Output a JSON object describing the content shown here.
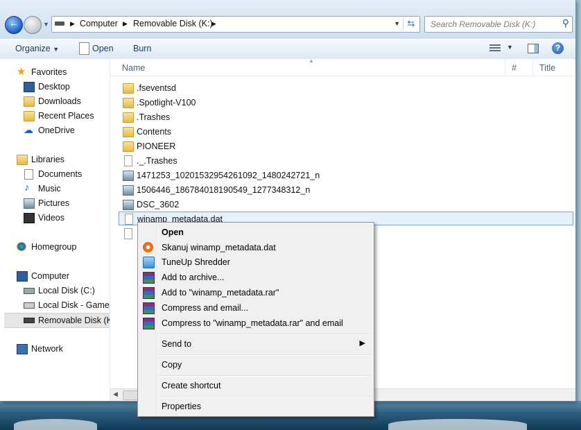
{
  "address_bar": {
    "segments": [
      "Computer",
      "Removable Disk (K:)"
    ]
  },
  "search": {
    "placeholder": "Search Removable Disk (K:)"
  },
  "toolbar": {
    "organize": "Organize",
    "open": "Open",
    "burn": "Burn"
  },
  "nav": {
    "favorites": "Favorites",
    "desktop": "Desktop",
    "downloads": "Downloads",
    "recent_places": "Recent Places",
    "onedrive": "OneDrive",
    "libraries": "Libraries",
    "documents": "Documents",
    "music": "Music",
    "pictures": "Pictures",
    "videos": "Videos",
    "homegroup": "Homegroup",
    "computer": "Computer",
    "local_disk_c": "Local Disk (C:)",
    "local_disk_games": "Local Disk - Games,",
    "removable_disk": "Removable Disk (K:",
    "network": "Network"
  },
  "columns": {
    "name": "Name",
    "number": "#",
    "title": "Title"
  },
  "files": [
    {
      "name": ".fseventsd",
      "type": "folder"
    },
    {
      "name": ".Spotlight-V100",
      "type": "folder"
    },
    {
      "name": ".Trashes",
      "type": "folder"
    },
    {
      "name": "Contents",
      "type": "folder"
    },
    {
      "name": "PIONEER",
      "type": "folder"
    },
    {
      "name": "._.Trashes",
      "type": "file"
    },
    {
      "name": "1471253_10201532954261092_1480242721_n",
      "type": "image"
    },
    {
      "name": "1506446_186784018190549_1277348312_n",
      "type": "image"
    },
    {
      "name": "DSC_3602",
      "type": "image"
    },
    {
      "name": "winamp_metadata.dat",
      "type": "file",
      "selected": true
    }
  ],
  "context_menu": {
    "open": "Open",
    "scan": "Skanuj winamp_metadata.dat",
    "tuneup": "TuneUp Shredder",
    "add_archive": "Add to archive...",
    "add_rar": "Add to \"winamp_metadata.rar\"",
    "compress_email": "Compress and email...",
    "compress_rar_email": "Compress to \"winamp_metadata.rar\" and email",
    "send_to": "Send to",
    "copy": "Copy",
    "create_shortcut": "Create shortcut",
    "properties": "Properties"
  },
  "icons": {
    "back": "back-arrow-icon",
    "forward": "forward-arrow-icon",
    "refresh": "refresh-icon",
    "search": "search-icon",
    "help": "help-icon"
  }
}
